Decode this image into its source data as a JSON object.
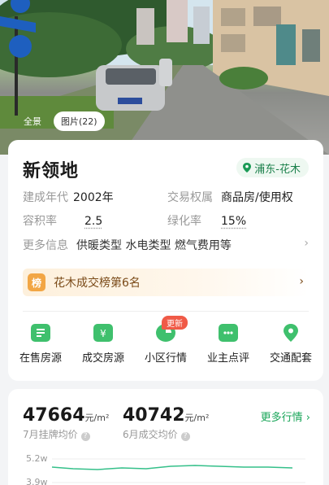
{
  "hero": {
    "tabs": [
      "全景",
      "图片(22)"
    ]
  },
  "community": {
    "name": "新领地",
    "location": "浦东-花木",
    "attributes": [
      {
        "label": "建成年代",
        "value": "2002年"
      },
      {
        "label": "交易权属",
        "value": "商品房/使用权"
      },
      {
        "label": "容积率",
        "value": "2.5"
      },
      {
        "label": "绿化率",
        "value": "15%"
      }
    ],
    "more_info": {
      "label": "更多信息",
      "value": "供暖类型 水电类型 燃气费用等"
    },
    "rank": {
      "badge": "榜",
      "text": "花木成交榜第6名"
    }
  },
  "nav": [
    {
      "label": "在售房源",
      "icon": "for-sale-icon"
    },
    {
      "label": "成交房源",
      "icon": "sold-icon"
    },
    {
      "label": "小区行情",
      "icon": "market-icon",
      "badge": "更新"
    },
    {
      "label": "业主点评",
      "icon": "comment-icon"
    },
    {
      "label": "交通配套",
      "icon": "location-icon"
    }
  ],
  "price": {
    "listing": {
      "value": "47664",
      "unit": "元/m²",
      "label": "7月挂牌均价"
    },
    "deal": {
      "value": "40742",
      "unit": "元/m²",
      "label": "6月成交均价"
    },
    "more": "更多行情",
    "y_ticks": [
      "5.2w",
      "3.9w"
    ]
  },
  "colors": {
    "accent": "#3fc06d",
    "brand_text": "#1a7f4a",
    "badge_red": "#f05a47",
    "rank_orange": "#f2a645"
  }
}
